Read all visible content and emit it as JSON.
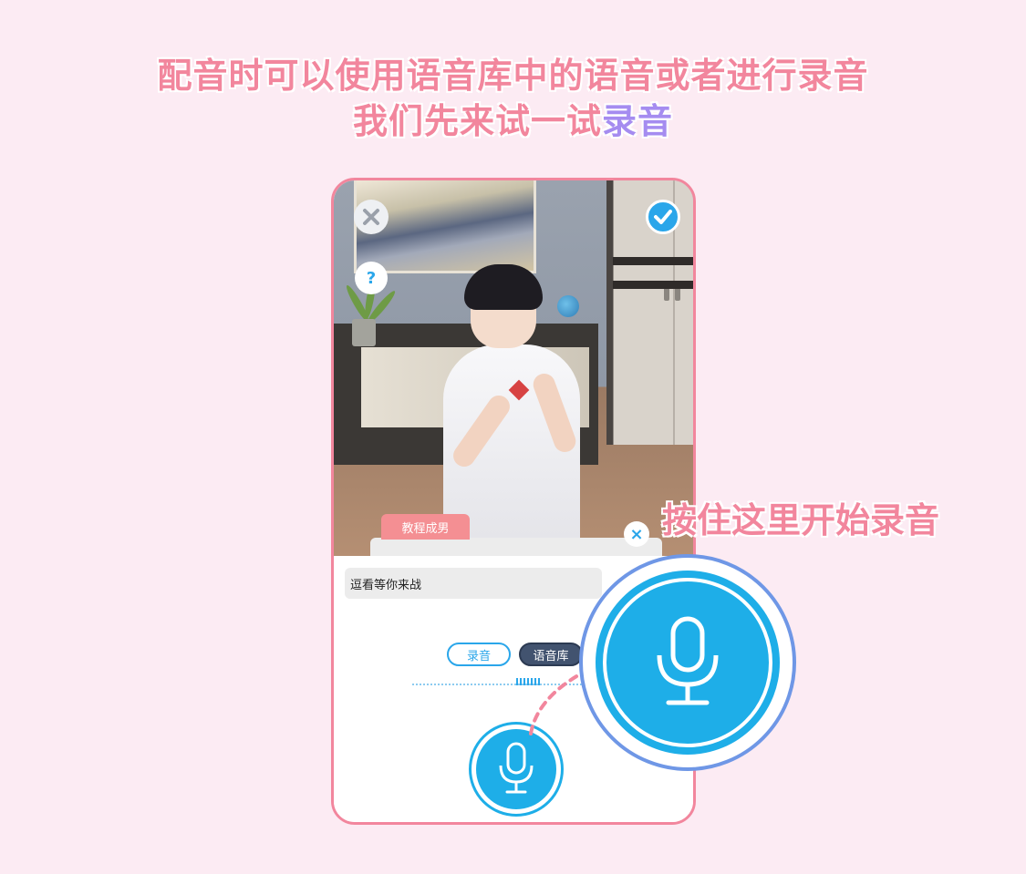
{
  "headline": {
    "line1": "配音时可以使用语音库中的语音或者进行录音",
    "line2_prefix": "我们先来试一试",
    "line2_accent": "录音"
  },
  "callout": {
    "text": "按住这里开始录音"
  },
  "scene": {
    "close_icon": "close-icon",
    "confirm_icon": "check-icon",
    "help_label": "?"
  },
  "panel": {
    "tab_label": "教程成男",
    "close_label": "×",
    "script_text": "逗看等你来战",
    "buttons": {
      "record": "录音",
      "library": "语音库"
    },
    "mic_icon": "microphone-icon"
  },
  "colors": {
    "accent_pink": "#f2869d",
    "accent_purple": "#a58cf0",
    "mic_blue": "#1eaee8",
    "callout_ring": "#6f97e6"
  }
}
